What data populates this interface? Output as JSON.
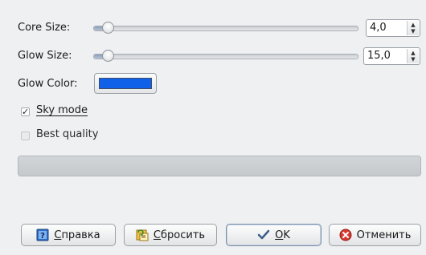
{
  "core_size": {
    "label": "Core Size:",
    "value": "4,0",
    "slider_level": 0.04
  },
  "glow_size": {
    "label": "Glow Size:",
    "value": "15,0",
    "slider_level": 0.04
  },
  "glow_color": {
    "label": "Glow Color:",
    "color": "#1060e8"
  },
  "sky_mode": {
    "label": "Sky mode",
    "checked": true
  },
  "best_quality": {
    "label": "Best quality",
    "checked": false
  },
  "buttons": {
    "help": "Справка",
    "reset": "Сбросить",
    "ok": "OK",
    "cancel": "Отменить"
  },
  "icons": {
    "help": "help-book-icon",
    "reset": "reset-icon",
    "ok": "checkmark-icon",
    "cancel": "cancel-icon"
  }
}
